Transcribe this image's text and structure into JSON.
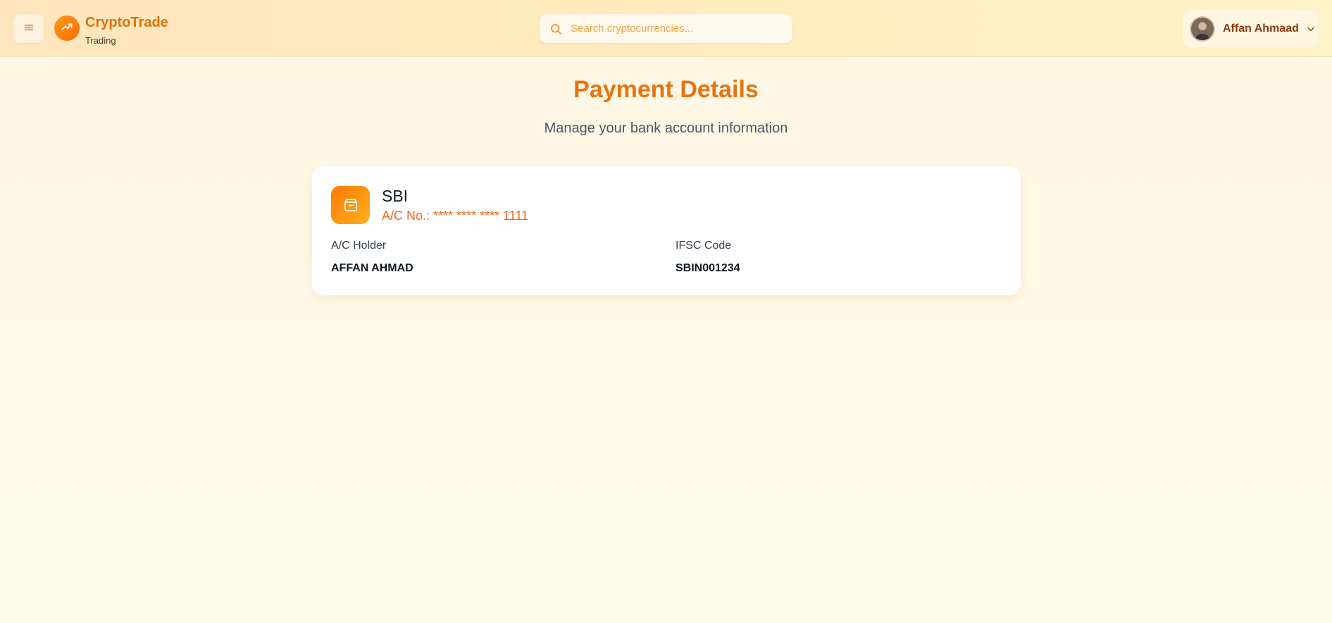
{
  "app": {
    "brand_name": "CryptoTrade",
    "brand_sub": "Trading"
  },
  "header": {
    "search_placeholder": "Search cryptocurrencies...",
    "user_name": "Affan Ahmaad"
  },
  "main": {
    "title": "Payment Details",
    "subtitle": "Manage your bank account information"
  },
  "bank_card": {
    "bank_name": "SBI",
    "account_label": "A/C No.:",
    "account_masked": "**** **** **** 1111",
    "holder_label": "A/C Holder",
    "holder_value": "AFFAN AHMAD",
    "ifsc_label": "IFSC Code",
    "ifsc_value": "SBIN001234"
  },
  "colors": {
    "accent": "#e7740e",
    "accent_light": "#ffa51f",
    "account_text": "#f26a1b"
  },
  "icons": [
    "menu-icon",
    "trending-up-icon",
    "search-icon",
    "chevron-down-icon",
    "bank-box-icon"
  ]
}
